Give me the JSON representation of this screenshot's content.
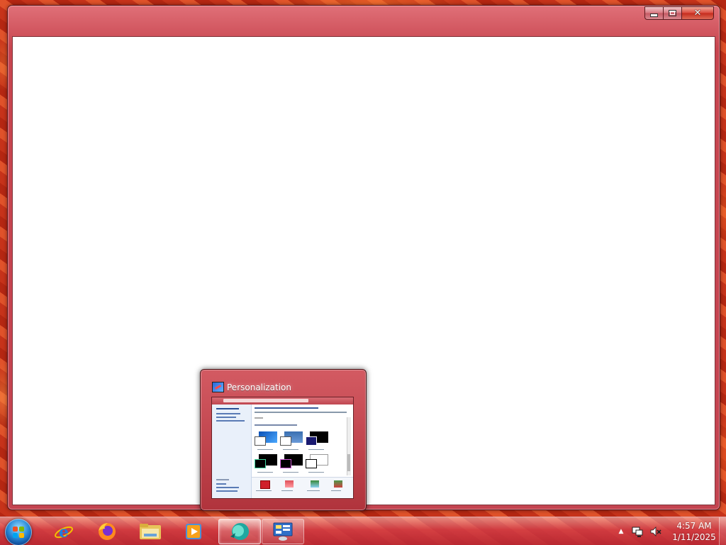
{
  "window": {
    "controls": {
      "minimize_icon": "minimize-icon",
      "maximize_icon": "maximize-icon",
      "close_icon": "close-icon",
      "close_glyph": "✕"
    },
    "content": ""
  },
  "thumbnail": {
    "title": "Personalization",
    "icon": "personalization-icon"
  },
  "taskbar": {
    "start_icon": "windows-start-icon",
    "pinned": [
      {
        "name": "internet-explorer",
        "icon": "internet-explorer-icon"
      },
      {
        "name": "firefox",
        "icon": "firefox-icon"
      },
      {
        "name": "file-explorer",
        "icon": "folder-icon"
      },
      {
        "name": "media-player",
        "icon": "media-player-icon"
      },
      {
        "name": "blue-circle-app",
        "icon": "blue-circle-app-icon",
        "state": "active"
      },
      {
        "name": "personalization",
        "icon": "control-panel-icon",
        "state": "open"
      }
    ],
    "tray": {
      "expand_glyph": "▲",
      "network_icon": "network-icon",
      "volume_icon": "volume-muted-icon",
      "time": "4:57 AM",
      "date": "1/11/2025"
    }
  },
  "colors": {
    "accent": "#c8454f",
    "window_frame": "#c44450",
    "client_bg": "#ffffff",
    "taskbar": "#c0303e"
  }
}
